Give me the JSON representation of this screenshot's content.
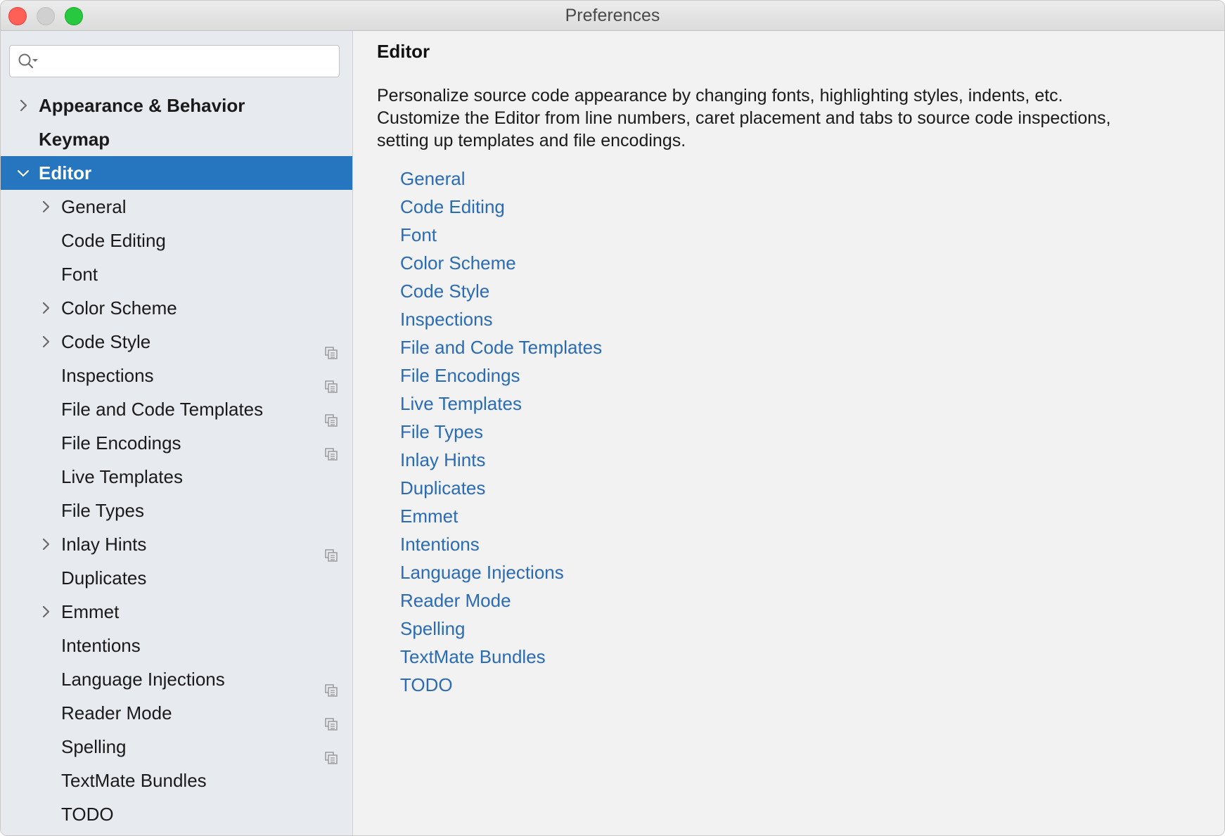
{
  "window": {
    "title": "Preferences"
  },
  "search": {
    "value": "",
    "placeholder": ""
  },
  "tree": {
    "items": [
      {
        "label": "Appearance & Behavior",
        "level": 0,
        "bold": true,
        "chevron": "right",
        "selected": false,
        "project_icon": false
      },
      {
        "label": "Keymap",
        "level": 0,
        "bold": true,
        "chevron": "none",
        "selected": false,
        "project_icon": false
      },
      {
        "label": "Editor",
        "level": 0,
        "bold": true,
        "chevron": "down",
        "selected": true,
        "project_icon": false
      },
      {
        "label": "General",
        "level": 1,
        "bold": false,
        "chevron": "right",
        "selected": false,
        "project_icon": false
      },
      {
        "label": "Code Editing",
        "level": 1,
        "bold": false,
        "chevron": "none",
        "selected": false,
        "project_icon": false
      },
      {
        "label": "Font",
        "level": 1,
        "bold": false,
        "chevron": "none",
        "selected": false,
        "project_icon": false
      },
      {
        "label": "Color Scheme",
        "level": 1,
        "bold": false,
        "chevron": "right",
        "selected": false,
        "project_icon": false
      },
      {
        "label": "Code Style",
        "level": 1,
        "bold": false,
        "chevron": "right",
        "selected": false,
        "project_icon": true
      },
      {
        "label": "Inspections",
        "level": 1,
        "bold": false,
        "chevron": "none",
        "selected": false,
        "project_icon": true
      },
      {
        "label": "File and Code Templates",
        "level": 1,
        "bold": false,
        "chevron": "none",
        "selected": false,
        "project_icon": true
      },
      {
        "label": "File Encodings",
        "level": 1,
        "bold": false,
        "chevron": "none",
        "selected": false,
        "project_icon": true
      },
      {
        "label": "Live Templates",
        "level": 1,
        "bold": false,
        "chevron": "none",
        "selected": false,
        "project_icon": false
      },
      {
        "label": "File Types",
        "level": 1,
        "bold": false,
        "chevron": "none",
        "selected": false,
        "project_icon": false
      },
      {
        "label": "Inlay Hints",
        "level": 1,
        "bold": false,
        "chevron": "right",
        "selected": false,
        "project_icon": true
      },
      {
        "label": "Duplicates",
        "level": 1,
        "bold": false,
        "chevron": "none",
        "selected": false,
        "project_icon": false
      },
      {
        "label": "Emmet",
        "level": 1,
        "bold": false,
        "chevron": "right",
        "selected": false,
        "project_icon": false
      },
      {
        "label": "Intentions",
        "level": 1,
        "bold": false,
        "chevron": "none",
        "selected": false,
        "project_icon": false
      },
      {
        "label": "Language Injections",
        "level": 1,
        "bold": false,
        "chevron": "none",
        "selected": false,
        "project_icon": true
      },
      {
        "label": "Reader Mode",
        "level": 1,
        "bold": false,
        "chevron": "none",
        "selected": false,
        "project_icon": true
      },
      {
        "label": "Spelling",
        "level": 1,
        "bold": false,
        "chevron": "none",
        "selected": false,
        "project_icon": true
      },
      {
        "label": "TextMate Bundles",
        "level": 1,
        "bold": false,
        "chevron": "none",
        "selected": false,
        "project_icon": false
      },
      {
        "label": "TODO",
        "level": 1,
        "bold": false,
        "chevron": "none",
        "selected": false,
        "project_icon": false
      }
    ]
  },
  "content": {
    "title": "Editor",
    "description": "Personalize source code appearance by changing fonts, highlighting styles, indents, etc.\nCustomize the Editor from line numbers, caret placement and tabs to source code inspections,\nsetting up templates and file encodings.",
    "links": [
      "General",
      "Code Editing",
      "Font",
      "Color Scheme",
      "Code Style",
      "Inspections",
      "File and Code Templates",
      "File Encodings",
      "Live Templates",
      "File Types",
      "Inlay Hints",
      "Duplicates",
      "Emmet",
      "Intentions",
      "Language Injections",
      "Reader Mode",
      "Spelling",
      "TextMate Bundles",
      "TODO"
    ]
  },
  "colors": {
    "selection": "#2675bf",
    "link": "#2a6bb5",
    "sidebar_bg": "#e7ebf0",
    "content_bg": "#f2f2f2"
  }
}
